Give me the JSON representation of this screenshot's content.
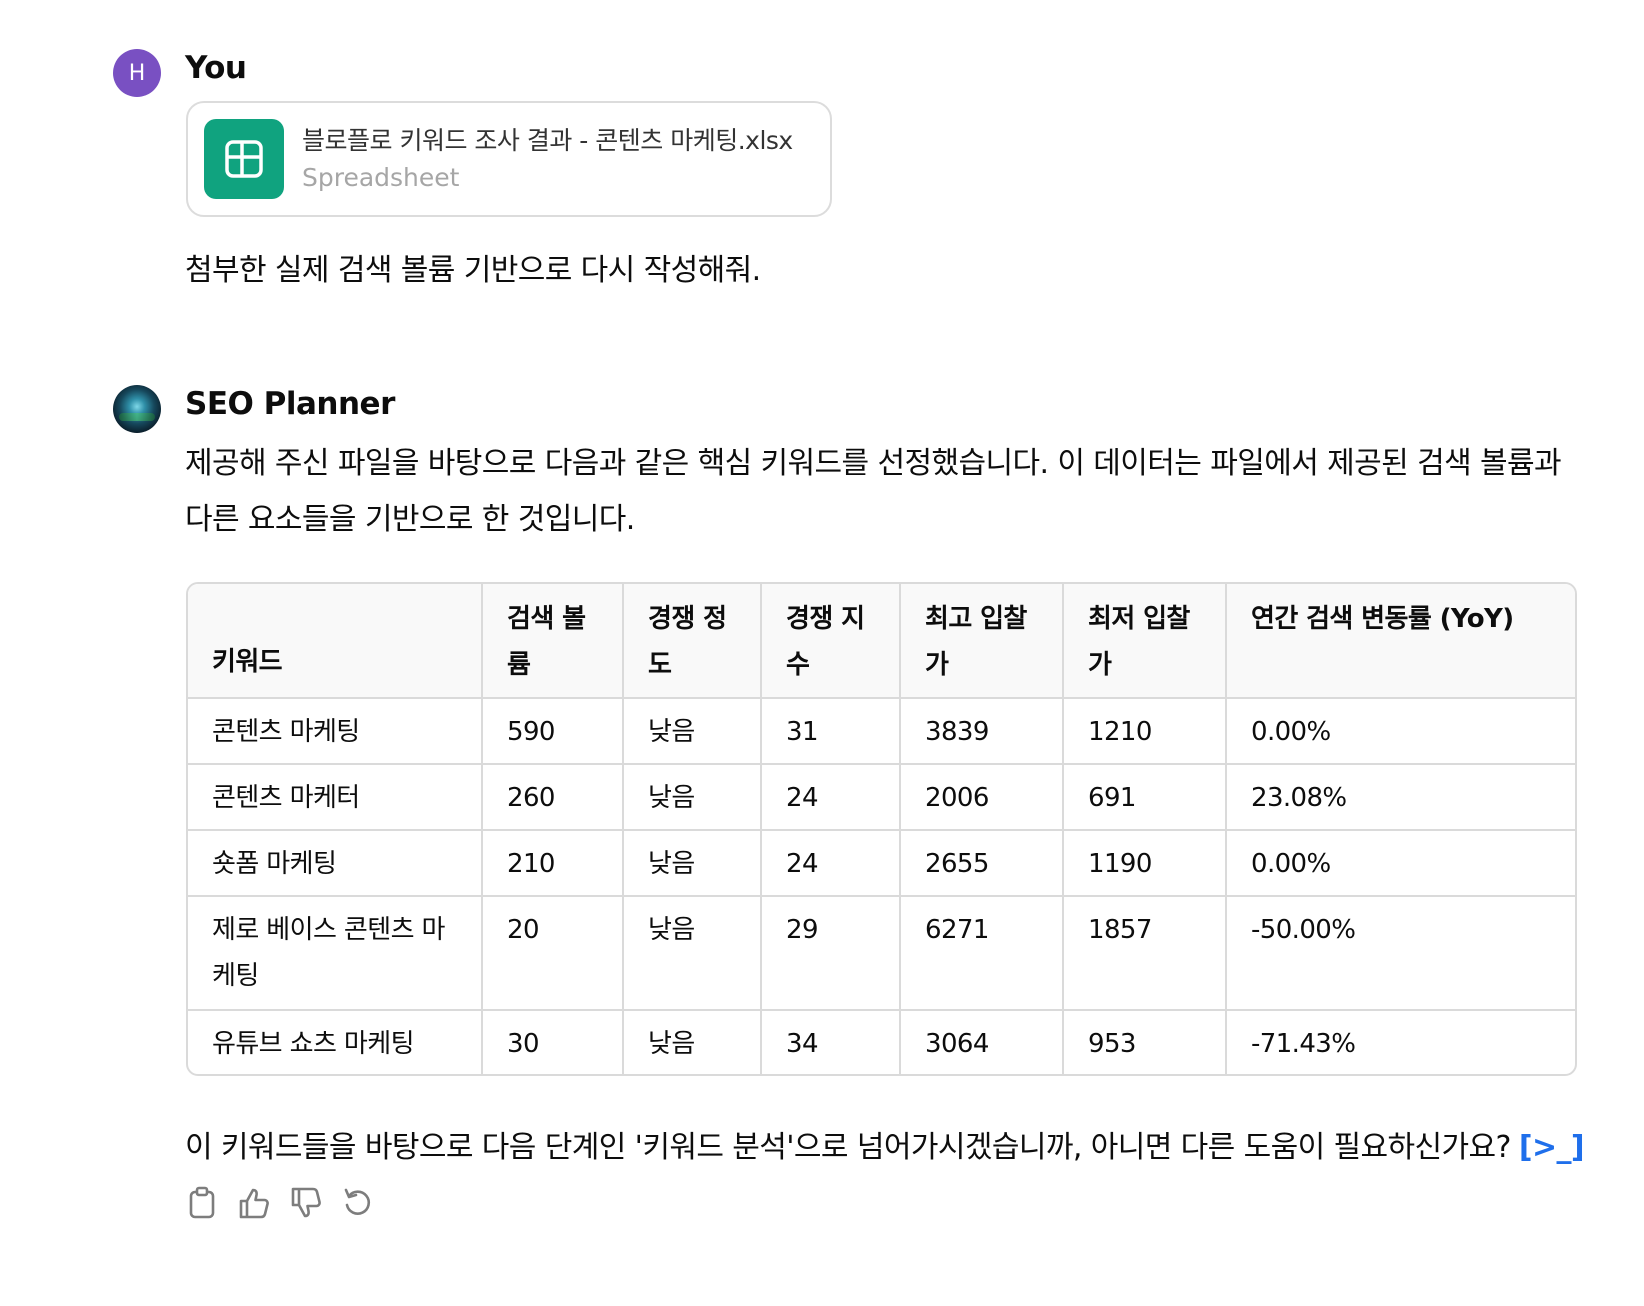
{
  "user": {
    "avatar_letter": "H",
    "avatar_color": "#7950c2",
    "name": "You",
    "attachment": {
      "file_name": "블로플로 키워드 조사 결과 - 콘텐츠 마케팅.xlsx",
      "file_type": "Spreadsheet",
      "icon": "spreadsheet-icon",
      "icon_color": "#10a37f"
    },
    "message": "첨부한 실제 검색 볼륨 기반으로 다시 작성해줘."
  },
  "assistant": {
    "name": "SEO Planner",
    "intro": "제공해 주신 파일을 바탕으로 다음과 같은 핵심 키워드를 선정했습니다. 이 데이터는 파일에서 제공된 검색 볼륨과 다른 요소들을 기반으로 한 것입니다.",
    "table": {
      "headers": [
        "키워드",
        "검색 볼륨",
        "경쟁 정도",
        "경쟁 지수",
        "최고 입찰가",
        "최저 입찰가",
        "연간 검색 변동률 (YoY)"
      ],
      "rows": [
        [
          "콘텐츠 마케팅",
          "590",
          "낮음",
          "31",
          "3839",
          "1210",
          "0.00%"
        ],
        [
          "콘텐츠 마케터",
          "260",
          "낮음",
          "24",
          "2006",
          "691",
          "23.08%"
        ],
        [
          "숏폼 마케팅",
          "210",
          "낮음",
          "24",
          "2655",
          "1190",
          "0.00%"
        ],
        [
          "제로 베이스 콘텐츠 마케팅",
          "20",
          "낮음",
          "29",
          "6271",
          "1857",
          "-50.00%"
        ],
        [
          "유튜브 쇼츠 마케팅",
          "30",
          "낮음",
          "34",
          "3064",
          "953",
          "-71.43%"
        ]
      ]
    },
    "follow_up": "이 키워드들을 바탕으로 다음 단계인 '키워드 분석'으로 넘어가시겠습니까, 아니면 다른 도움이 필요하신가요?",
    "follow_up_icon": "[>_]",
    "actions": [
      "copy-icon",
      "thumbs-up-icon",
      "thumbs-down-icon",
      "regenerate-icon"
    ]
  }
}
